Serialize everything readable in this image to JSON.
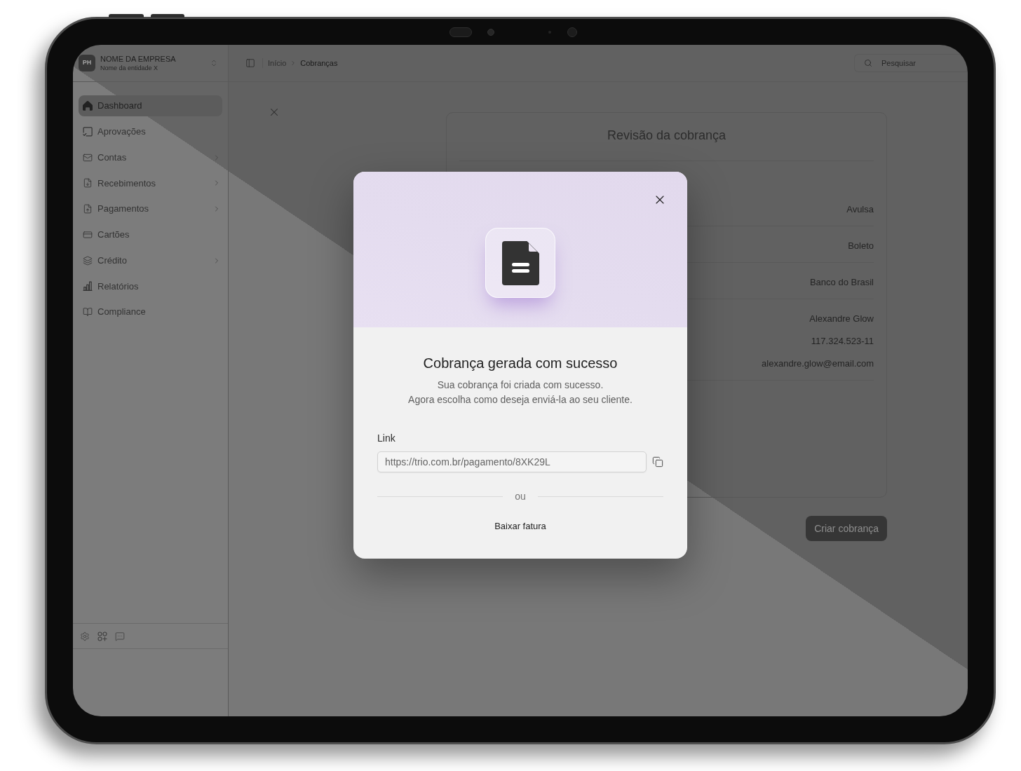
{
  "sidebar": {
    "workspace": {
      "avatar": "PH",
      "name": "NOME DA EMPRESA",
      "subtitle": "Nome da entidade X"
    },
    "items": [
      {
        "label": "Dashboard",
        "selected": true,
        "expandable": false
      },
      {
        "label": "Aprovações",
        "selected": false,
        "expandable": false
      },
      {
        "label": "Contas",
        "selected": false,
        "expandable": true
      },
      {
        "label": "Recebimentos",
        "selected": false,
        "expandable": true
      },
      {
        "label": "Pagamentos",
        "selected": false,
        "expandable": true
      },
      {
        "label": "Cartões",
        "selected": false,
        "expandable": false
      },
      {
        "label": "Crédito",
        "selected": false,
        "expandable": true
      },
      {
        "label": "Relatórios",
        "selected": false,
        "expandable": false
      },
      {
        "label": "Compliance",
        "selected": false,
        "expandable": false
      }
    ]
  },
  "top_bar": {
    "breadcrumb": [
      {
        "label": "Início",
        "current": false
      },
      {
        "label": "Cobranças",
        "current": true
      }
    ],
    "search": {
      "placeholder": "Pesquisar"
    }
  },
  "review_card": {
    "title": "Revisão da cobrança",
    "rows": [
      {
        "values": [
          "Avulsa"
        ]
      },
      {
        "values": [
          "Boleto"
        ]
      },
      {
        "values": [
          "Banco do Brasil"
        ]
      },
      {
        "values": [
          "Alexandre Glow",
          "117.324.523-11",
          "alexandre.glow@email.com"
        ]
      }
    ]
  },
  "primary_button": {
    "label": "Criar cobrança"
  },
  "dialog": {
    "title": "Cobrança gerada com sucesso",
    "message": [
      "Sua cobrança foi criada com sucesso.",
      "Agora escolha como deseja enviá-la ao seu cliente."
    ],
    "link": {
      "label": "Link",
      "value": "https://trio.com.br/pagamento/8XK29L"
    },
    "divider": "ou",
    "action": "Baixar fatura"
  }
}
